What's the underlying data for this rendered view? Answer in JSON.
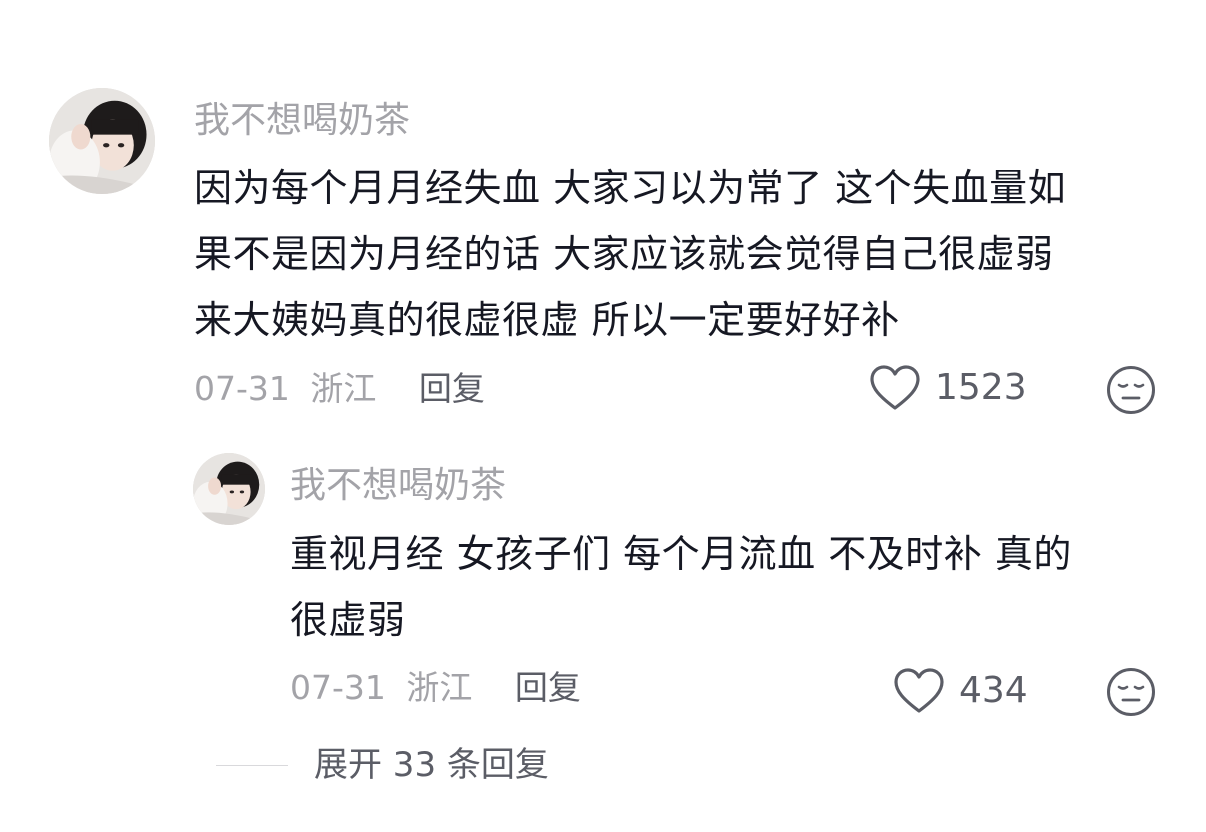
{
  "comment": {
    "username": "我不想喝奶茶",
    "content_lines": [
      "因为每个月月经失血 大家习以为常了 这个失血量如",
      "果不是因为月经的话 大家应该就会觉得自己很虚弱",
      "来大姨妈真的很虚很虚 所以一定要好好补"
    ],
    "date": "07-31",
    "location": "浙江",
    "reply_label": "回复",
    "likes": "1523",
    "like_icon": "heart-outline-icon",
    "emoji_icon": "expressionless-face-icon"
  },
  "reply": {
    "username": "我不想喝奶茶",
    "content_lines": [
      "重视月经 女孩子们 每个月流血 不及时补 真的",
      "很虚弱"
    ],
    "date": "07-31",
    "location": "浙江",
    "reply_label": "回复",
    "likes": "434",
    "like_icon": "heart-outline-icon",
    "emoji_icon": "expressionless-face-icon"
  },
  "expand_replies": {
    "label": "展开 33 条回复"
  }
}
